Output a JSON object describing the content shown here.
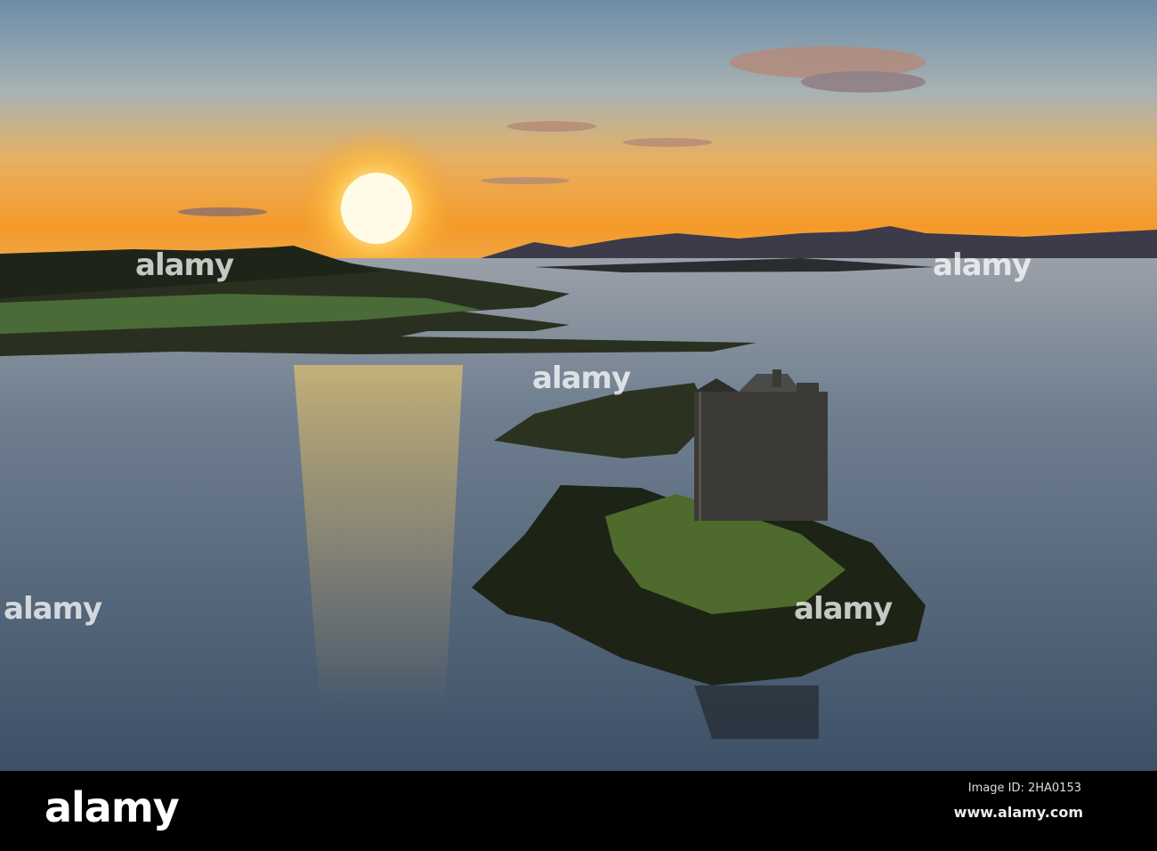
{
  "watermark": {
    "text": "alamy"
  },
  "footer": {
    "logo": "alamy",
    "image_id": "Image ID: 2HA0153",
    "url": "www.alamy.com"
  },
  "colors": {
    "sun": "#fff6c8",
    "sky_top": "#6f8ea8",
    "horizon": "#f5a030",
    "water": "#56687a",
    "bar": "#000000"
  }
}
